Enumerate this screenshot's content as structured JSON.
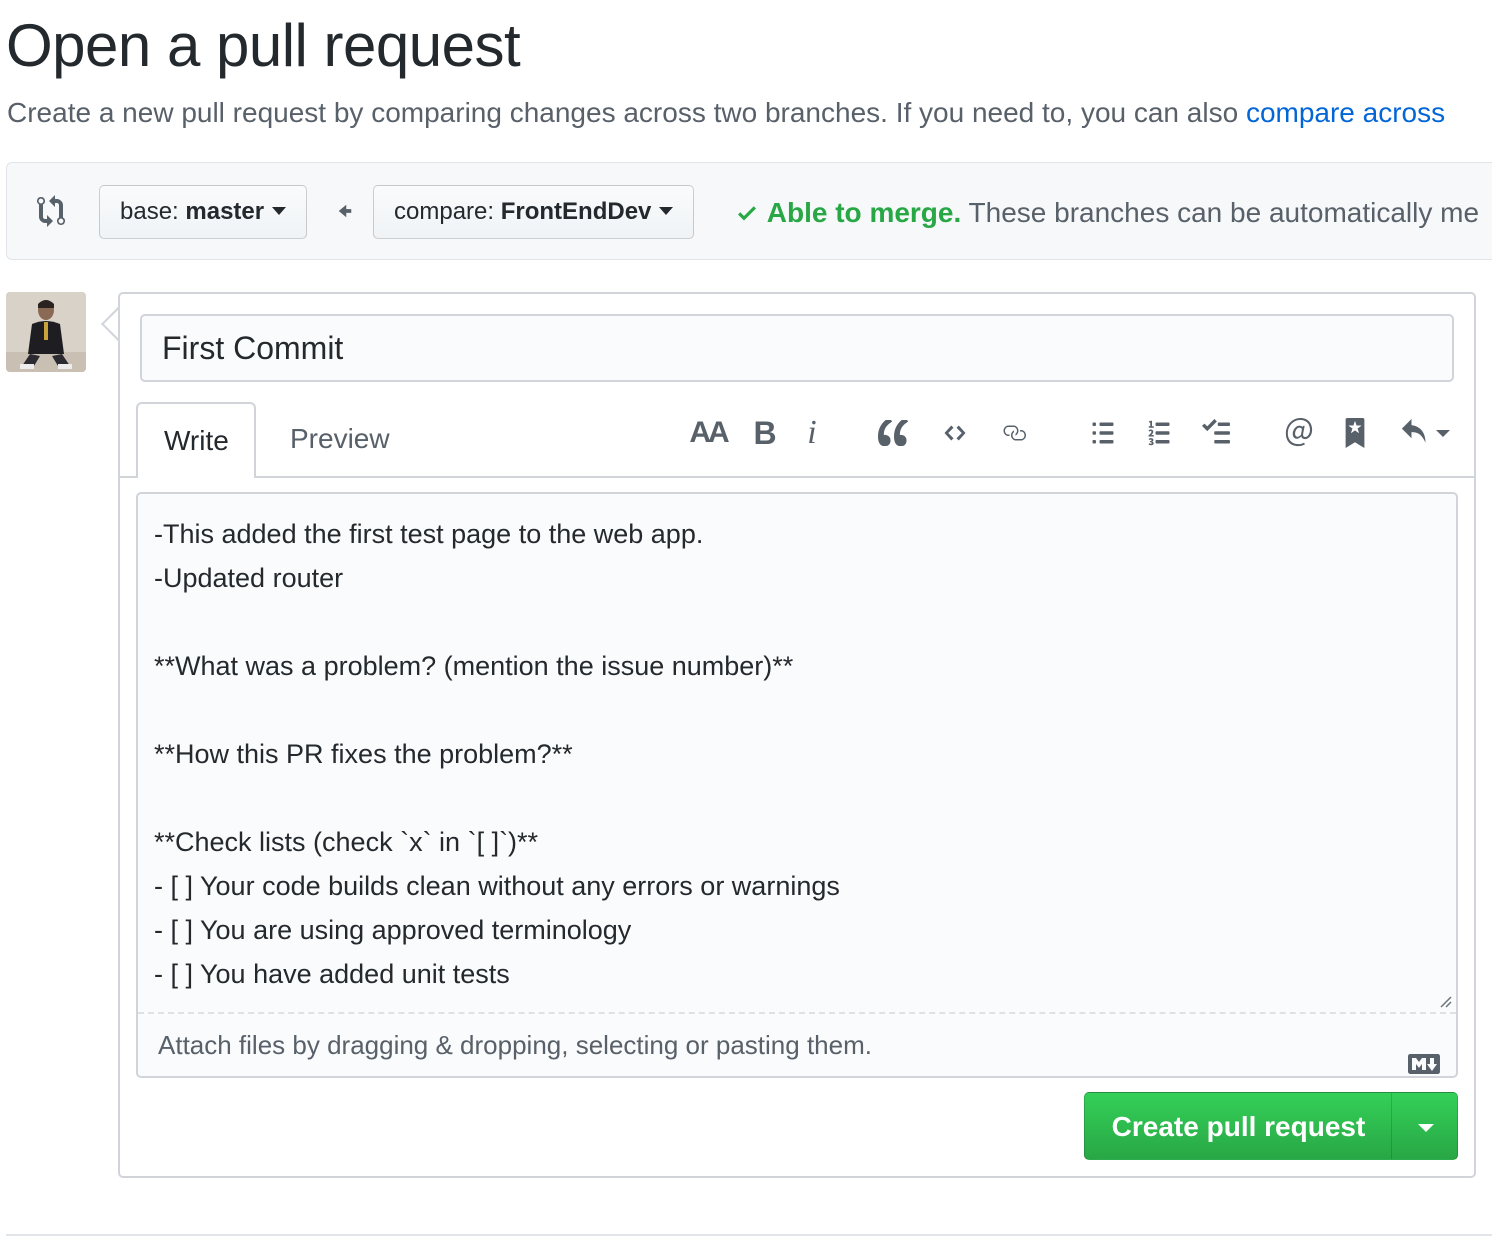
{
  "page": {
    "title": "Open a pull request",
    "subtitle_text": "Create a new pull request by comparing changes across two branches. If you need to, you can also ",
    "subtitle_link": "compare across"
  },
  "range": {
    "base_prefix": "base: ",
    "base_branch": "master",
    "compare_prefix": "compare: ",
    "compare_branch": "FrontEndDev",
    "merge_ok": "Able to merge.",
    "merge_text": " These branches can be automatically me"
  },
  "composer": {
    "title_value": "First Commit",
    "tabs": {
      "write": "Write",
      "preview": "Preview"
    },
    "toolbar": {
      "heading": "AA",
      "bold": "B",
      "italic": "i",
      "icons": [
        "heading-icon",
        "bold-icon",
        "italic-icon",
        "quote-icon",
        "code-icon",
        "link-icon",
        "bulleted-list-icon",
        "numbered-list-icon",
        "task-list-icon",
        "mention-icon",
        "reference-icon",
        "saved-replies-icon"
      ]
    },
    "body": "-This added the first test page to the web app.\n-Updated router\n\n**What was a problem? (mention the issue number)**\n\n**How this PR fixes the problem?**\n\n**Check lists (check `x` in `[ ]`)**\n- [ ] Your code builds clean without any errors or warnings\n- [ ] You are using approved terminology\n- [ ] You have added unit tests",
    "attach_text": "Attach files by dragging & dropping, selecting or pasting them.",
    "submit_label": "Create pull request"
  },
  "colors": {
    "accent_link": "#0366d6",
    "merge_green": "#28a745",
    "button_green": "#2ea44f"
  }
}
